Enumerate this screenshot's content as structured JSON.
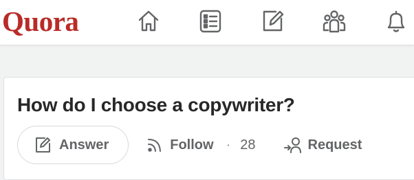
{
  "header": {
    "logo_text": "Quora",
    "brand_color": "#b92b27",
    "nav_icons": [
      "home-icon",
      "list-icon",
      "edit-icon",
      "people-icon",
      "bell-icon"
    ]
  },
  "question": {
    "title": "How do I choose a copywriter?",
    "actions": {
      "answer_label": "Answer",
      "follow_label": "Follow",
      "follow_separator": "·",
      "follow_count": "28",
      "request_label": "Request"
    }
  }
}
